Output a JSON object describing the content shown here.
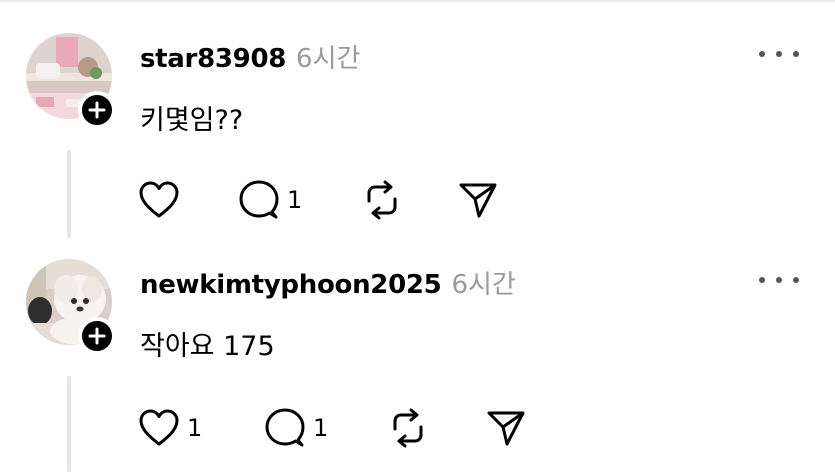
{
  "posts": [
    {
      "username": "star83908",
      "timestamp": "6시간",
      "text": "키몇임??",
      "like_count": "",
      "reply_count": "1"
    },
    {
      "username": "newkimtyphoon2025",
      "timestamp": "6시간",
      "text": "작아요 175",
      "like_count": "1",
      "reply_count": "1"
    }
  ]
}
